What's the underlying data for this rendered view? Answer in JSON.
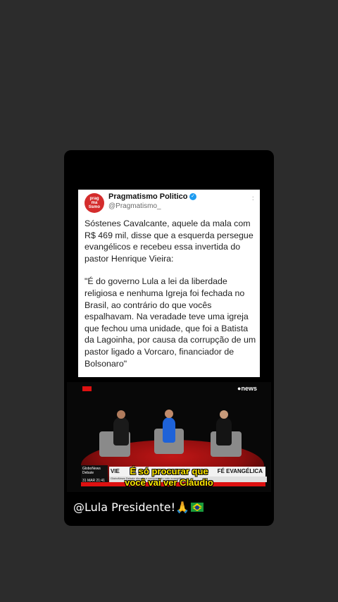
{
  "tweet": {
    "avatar_text": "prag\nma\ntismo",
    "account_name": "Pragmatismo Politico",
    "account_handle": "@Pragmatismo_",
    "paragraph1": "Sóstenes Cavalcante, aquele da mala com R$ 469 mil, disse que a esquerda persegue evangélicos e recebeu essa invertida do pastor Henrique Vieira:",
    "paragraph2": "\"É do governo Lula a lei da liberdade religiosa e nenhuma Igreja foi fechada no Brasil, ao contrário do que vocês espalhavam. Na veradade teve uma igreja que fechou uma unidade, que foi a Batista da Lagoinha, por causa da corrupção de um pastor ligado a Vorcaro, financiador de Bolsonaro\""
  },
  "video": {
    "network_logo": "●news",
    "chyron_program": "GloboNews Debate",
    "chyron_date": "31 MAR 21:41",
    "chyron_heading_left": "VIE",
    "chyron_heading_right": "FÉ EVANGÉLICA",
    "chyron_sub": "GloboNews Debate discute a conquista do voto evangélico",
    "subtitle_line1": "É só procurar que",
    "subtitle_line2": "você vai ver Cláudio"
  },
  "story": {
    "caption": "@Lula Presidente!🙏"
  },
  "colors": {
    "background": "#2c2c2c",
    "avatar_red": "#d42c2c",
    "verified_blue": "#1d9bf0",
    "subtitle_yellow": "#ffe600"
  }
}
